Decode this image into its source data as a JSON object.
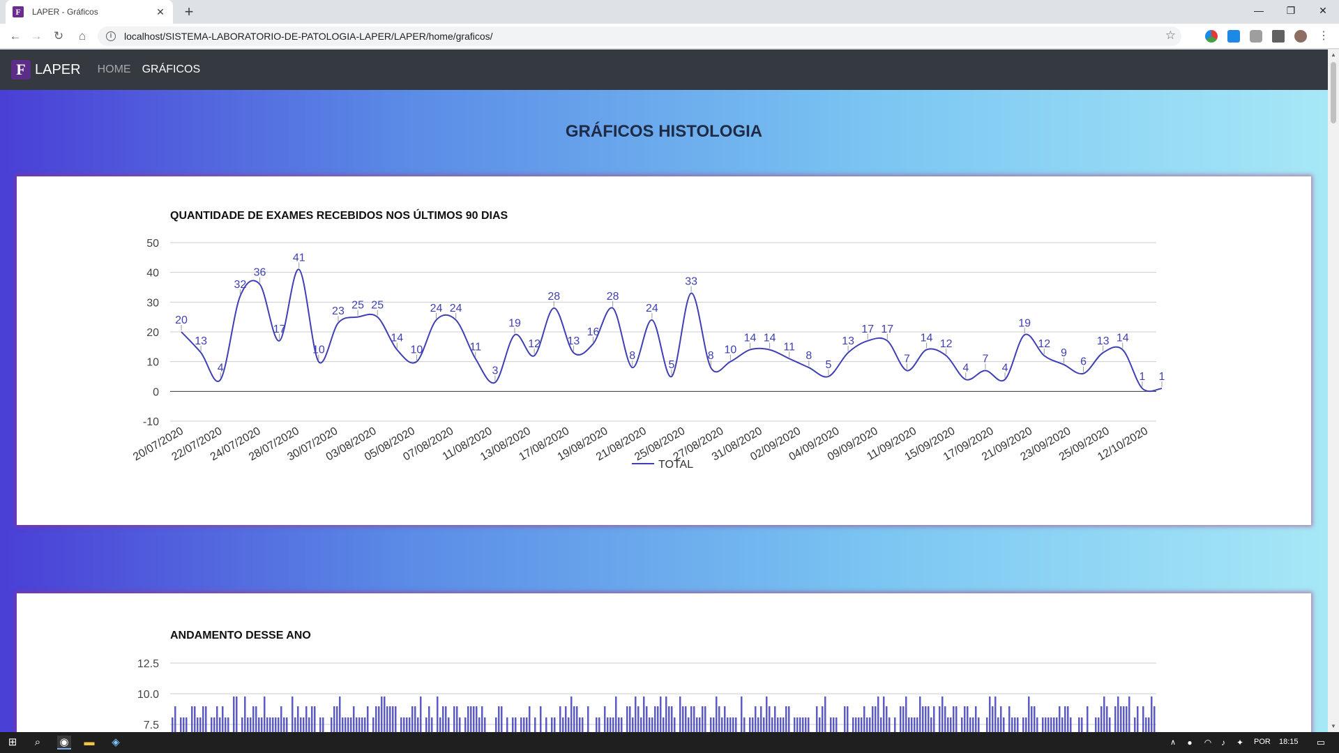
{
  "browser": {
    "tab_title": "LAPER - Gráficos",
    "favicon_letter": "F",
    "tab_close": "✕",
    "new_tab": "+",
    "url": "localhost/SISTEMA-LABORATORIO-DE-PATOLOGIA-LAPER/LAPER/home/graficos/",
    "window_controls": {
      "minimize": "—",
      "restore": "❐",
      "close": "✕"
    }
  },
  "navbar": {
    "logo_letter": "F",
    "brand": "LAPER",
    "links": [
      "HOME",
      "GRÁFICOS"
    ],
    "active_link": "GRÁFICOS"
  },
  "page": {
    "title": "GRÁFICOS HISTOLOGIA"
  },
  "charts": {
    "chart1_title": "QUANTIDADE DE EXAMES RECEBIDOS NOS ÚLTIMOS 90 DIAS",
    "chart2_title": "ANDAMENTO DESSE ANO"
  },
  "chart_data": [
    {
      "type": "line",
      "title": "QUANTIDADE DE EXAMES RECEBIDOS NOS ÚLTIMOS 90 DIAS",
      "ylim": [
        -10,
        50
      ],
      "yticks": [
        50,
        40,
        30,
        20,
        10,
        0,
        -10
      ],
      "xticks": [
        "20/07/2020",
        "22/07/2020",
        "24/07/2020",
        "28/07/2020",
        "30/07/2020",
        "03/08/2020",
        "05/08/2020",
        "07/08/2020",
        "11/08/2020",
        "13/08/2020",
        "17/08/2020",
        "19/08/2020",
        "21/08/2020",
        "25/08/2020",
        "27/08/2020",
        "31/08/2020",
        "02/09/2020",
        "04/09/2020",
        "09/09/2020",
        "11/09/2020",
        "15/09/2020",
        "17/09/2020",
        "21/09/2020",
        "23/09/2020",
        "25/09/2020",
        "12/10/2020"
      ],
      "series": [
        {
          "name": "TOTAL",
          "color": "#3f3fb5",
          "values": [
            20,
            13,
            4,
            32,
            36,
            17,
            41,
            10,
            23,
            25,
            25,
            14,
            10,
            24,
            24,
            11,
            3,
            19,
            12,
            28,
            13,
            16,
            28,
            8,
            24,
            5,
            33,
            8,
            10,
            14,
            14,
            11,
            8,
            5,
            13,
            17,
            17,
            7,
            14,
            12,
            4,
            7,
            4,
            19,
            12,
            9,
            6,
            13,
            14,
            1,
            1
          ]
        }
      ],
      "legend": "bottom",
      "grid": true
    },
    {
      "type": "bar",
      "title": "ANDAMENTO DESSE ANO",
      "yticks": [
        12.5,
        10.0,
        7.5
      ],
      "series": [
        {
          "color": "#3f3fb5"
        }
      ],
      "grid": true
    }
  ],
  "taskbar": {
    "language": "POR",
    "time": "18:15"
  }
}
